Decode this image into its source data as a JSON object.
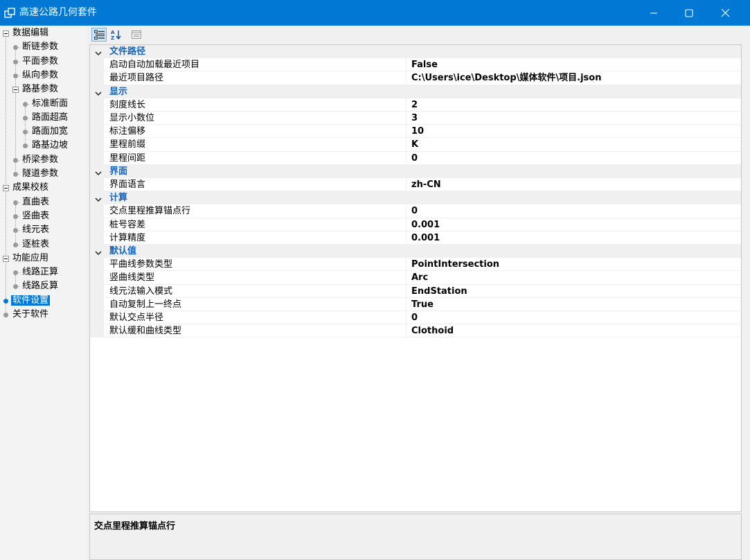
{
  "window": {
    "title": "高速公路几何套件",
    "app_icon": "app-window-icon",
    "controls": [
      "minimize-icon",
      "maximize-icon",
      "close-icon"
    ]
  },
  "tree": [
    {
      "label": "数据编辑",
      "level": 0,
      "kind": "expander"
    },
    {
      "label": "断链参数",
      "level": 1,
      "kind": "leaf"
    },
    {
      "label": "平面参数",
      "level": 1,
      "kind": "leaf"
    },
    {
      "label": "纵向参数",
      "level": 1,
      "kind": "leaf"
    },
    {
      "label": "路基参数",
      "level": 1,
      "kind": "expander"
    },
    {
      "label": "标准断面",
      "level": 2,
      "kind": "leaf"
    },
    {
      "label": "路面超高",
      "level": 2,
      "kind": "leaf"
    },
    {
      "label": "路面加宽",
      "level": 2,
      "kind": "leaf"
    },
    {
      "label": "路基边坡",
      "level": 2,
      "kind": "leaf"
    },
    {
      "label": "桥梁参数",
      "level": 1,
      "kind": "leaf"
    },
    {
      "label": "隧道参数",
      "level": 1,
      "kind": "leaf"
    },
    {
      "label": "成果校核",
      "level": 0,
      "kind": "expander"
    },
    {
      "label": "直曲表",
      "level": 1,
      "kind": "leaf"
    },
    {
      "label": "竖曲表",
      "level": 1,
      "kind": "leaf"
    },
    {
      "label": "线元表",
      "level": 1,
      "kind": "leaf"
    },
    {
      "label": "逐桩表",
      "level": 1,
      "kind": "leaf"
    },
    {
      "label": "功能应用",
      "level": 0,
      "kind": "expander"
    },
    {
      "label": "线路正算",
      "level": 1,
      "kind": "leaf"
    },
    {
      "label": "线路反算",
      "level": 1,
      "kind": "leaf"
    },
    {
      "label": "软件设置",
      "level": 0,
      "kind": "leaf",
      "selected": true
    },
    {
      "label": "关于软件",
      "level": 0,
      "kind": "leaf"
    }
  ],
  "toolbar": {
    "buttons": [
      {
        "icon": "categorized-view-icon",
        "active": true
      },
      {
        "icon": "alphabetical-sort-icon",
        "active": false
      },
      {
        "icon": "property-pages-icon",
        "active": false
      }
    ]
  },
  "property_grid": {
    "categories": [
      {
        "name": "文件路径",
        "props": [
          {
            "name": "启动自动加载最近项目",
            "value": "False"
          },
          {
            "name": "最近项目路径",
            "value": "C:\\Users\\ice\\Desktop\\媒体软件\\项目.json"
          }
        ]
      },
      {
        "name": "显示",
        "props": [
          {
            "name": "刻度线长",
            "value": "2"
          },
          {
            "name": "显示小数位",
            "value": "3"
          },
          {
            "name": "标注偏移",
            "value": "10"
          },
          {
            "name": "里程前缀",
            "value": "K"
          },
          {
            "name": "里程间距",
            "value": "0"
          }
        ]
      },
      {
        "name": "界面",
        "props": [
          {
            "name": "界面语言",
            "value": "zh-CN"
          }
        ]
      },
      {
        "name": "计算",
        "props": [
          {
            "name": "交点里程推算锚点行",
            "value": "0"
          },
          {
            "name": "桩号容差",
            "value": "0.001"
          },
          {
            "name": "计算精度",
            "value": "0.001"
          }
        ]
      },
      {
        "name": "默认值",
        "props": [
          {
            "name": "平曲线参数类型",
            "value": "PointIntersection"
          },
          {
            "name": "竖曲线类型",
            "value": "Arc"
          },
          {
            "name": "线元法输入模式",
            "value": "EndStation"
          },
          {
            "name": "自动复制上一终点",
            "value": "True"
          },
          {
            "name": "默认交点半径",
            "value": "0"
          },
          {
            "name": "默认缓和曲线类型",
            "value": "Clothoid"
          }
        ]
      }
    ]
  },
  "description": {
    "title": "交点里程推算锚点行"
  }
}
